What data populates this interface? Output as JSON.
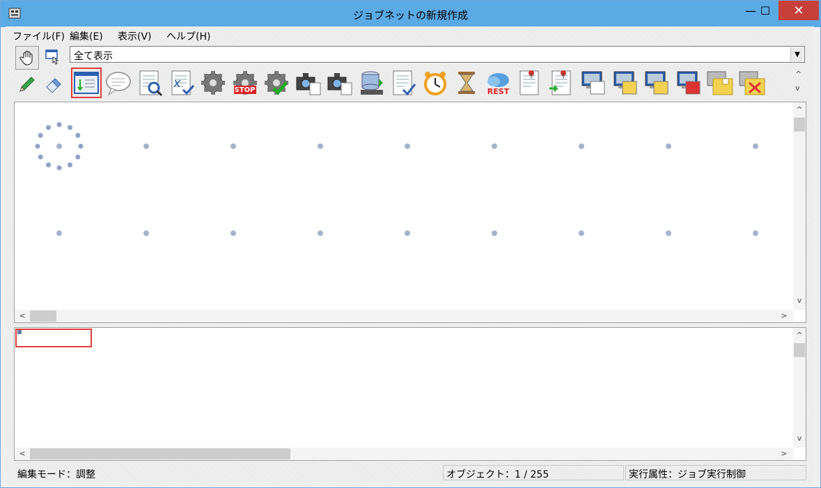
{
  "window": {
    "title": "ジョブネットの新規作成",
    "minimize_glyph": "—",
    "maximize_glyph": "☐",
    "close_glyph": "✕"
  },
  "menu": {
    "items": [
      {
        "label": "ファイル(F)"
      },
      {
        "label": "編集(E)"
      },
      {
        "label": "表示(V)"
      },
      {
        "label": "ヘルプ(H)"
      }
    ]
  },
  "mode_tools": {
    "icons": [
      "hand-icon",
      "select-window-icon",
      "pencil-icon",
      "eraser-icon"
    ]
  },
  "filter": {
    "value": "全て表示",
    "arrow": "▼"
  },
  "toolbar": {
    "selected_index": 0,
    "icons": [
      "jobnet-icon",
      "comment-icon",
      "document-search-icon",
      "variable-check-icon",
      "gear-icon",
      "gear-stop-icon",
      "gear-check-icon",
      "camera-document-icon",
      "camera-message-icon",
      "database-arrow-icon",
      "document-check-icon",
      "alarm-clock-icon",
      "hourglass-icon",
      "rest-cloud-icon",
      "document-pin-icon",
      "document-pin-arrow-icon",
      "monitor-document-icon",
      "monitor-folder-icon",
      "monitor-message-icon",
      "monitor-delete-icon",
      "folder-new-icon",
      "folder-delete-icon"
    ],
    "stop_text": "STOP",
    "rest_text": "REST",
    "scroll_up": "^",
    "scroll_down": "v"
  },
  "status": {
    "edit_mode": "編集モード：調整",
    "object_count": "オブジェクト：1 / 255",
    "exec_attr": "実行属性：ジョブ実行制御"
  },
  "scroll": {
    "up": "^",
    "down": "v",
    "left": "<",
    "right": ">"
  }
}
